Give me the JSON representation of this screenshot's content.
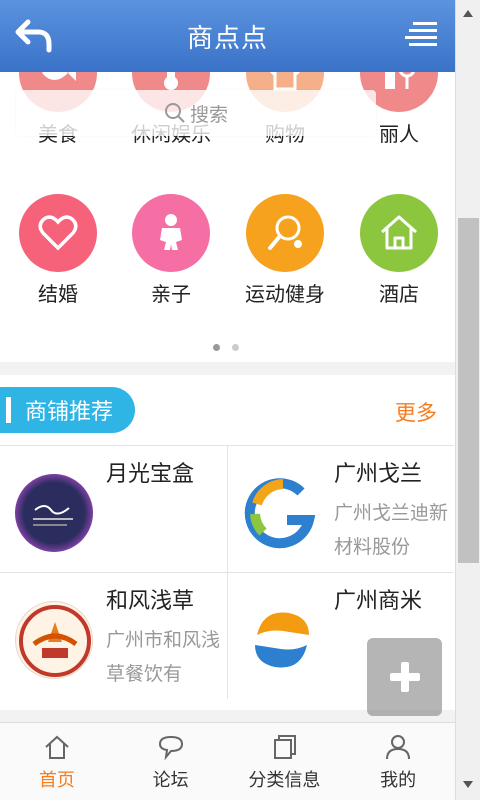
{
  "header": {
    "title": "商点点"
  },
  "search": {
    "placeholder": "搜索"
  },
  "categories": [
    {
      "label": "美食",
      "icon": "fish-icon",
      "color": "#f07a7a"
    },
    {
      "label": "休闲娱乐",
      "icon": "thermometer-icon",
      "color": "#f07a7a"
    },
    {
      "label": "购物",
      "icon": "shirt-icon",
      "color": "#f4a77a"
    },
    {
      "label": "丽人",
      "icon": "lipstick-icon",
      "color": "#f07a7a"
    },
    {
      "label": "结婚",
      "icon": "heart-icon",
      "color": "#f5627a"
    },
    {
      "label": "亲子",
      "icon": "baby-icon",
      "color": "#f56fa5"
    },
    {
      "label": "运动健身",
      "icon": "pingpong-icon",
      "color": "#f6a21e"
    },
    {
      "label": "酒店",
      "icon": "house-icon",
      "color": "#8cc63f"
    }
  ],
  "shops": {
    "title": "商铺推荐",
    "more": "更多",
    "items": [
      {
        "name": "月光宝盒",
        "desc": ""
      },
      {
        "name": "广州戈兰",
        "desc": "广州戈兰迪新材料股份"
      },
      {
        "name": "和风浅草",
        "desc": "广州市和风浅草餐饮有"
      },
      {
        "name": "广州商米",
        "desc": ""
      }
    ]
  },
  "nav": [
    {
      "label": "首页",
      "icon": "home-icon",
      "active": true
    },
    {
      "label": "论坛",
      "icon": "chat-bubble-icon",
      "active": false
    },
    {
      "label": "分类信息",
      "icon": "cards-icon",
      "active": false
    },
    {
      "label": "我的",
      "icon": "user-icon",
      "active": false
    }
  ],
  "colors": {
    "header": "#4a84d6",
    "accent": "#f57c1f",
    "pill": "#2fb4e6"
  }
}
